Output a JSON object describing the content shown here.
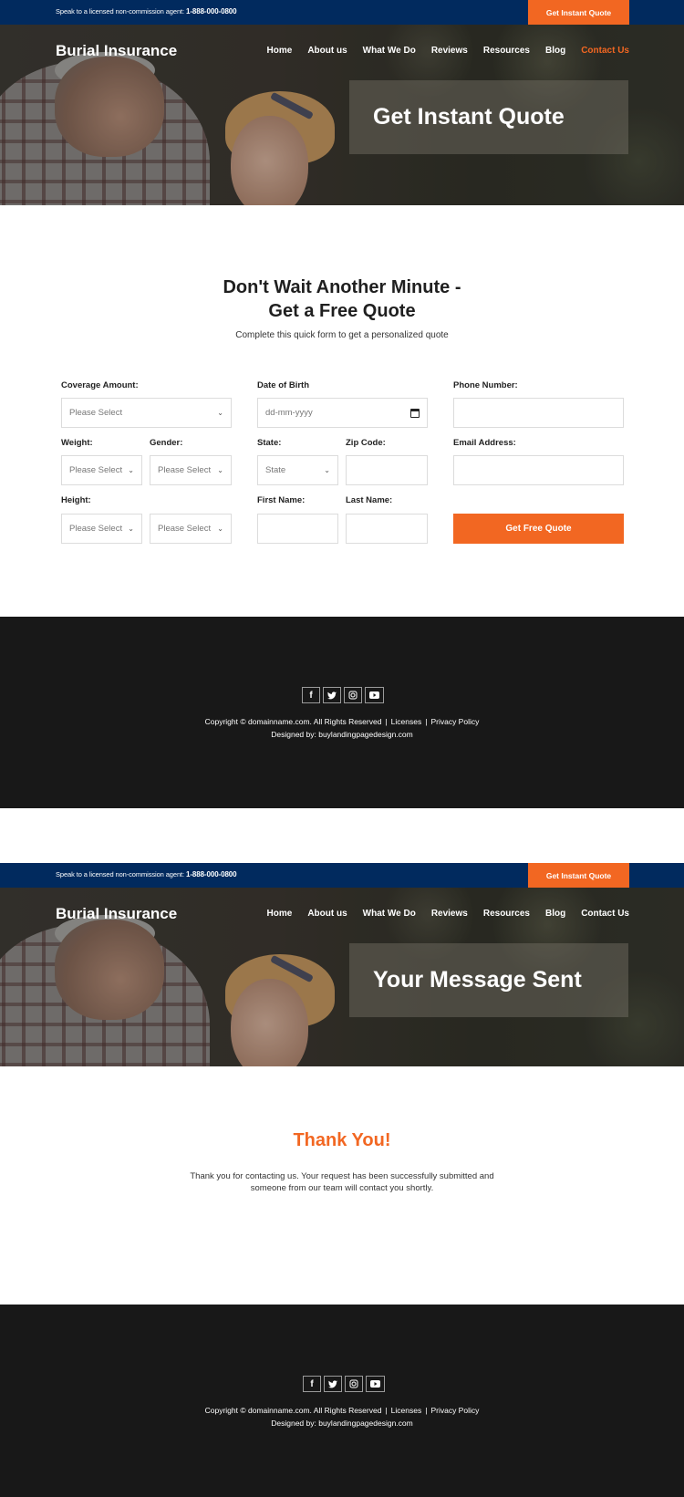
{
  "colors": {
    "navy": "#012a5e",
    "orange": "#f26722",
    "footer_bg": "#181818"
  },
  "topbar": {
    "agent_text": "Speak to a licensed non-commission agent: ",
    "phone": "1-888-000-0800",
    "quote_button": "Get Instant Quote"
  },
  "header": {
    "brand": "Burial Insurance",
    "nav": [
      "Home",
      "About us",
      "What We Do",
      "Reviews",
      "Resources",
      "Blog",
      "Contact Us"
    ]
  },
  "page1": {
    "hero_title": "Get Instant Quote",
    "heading_line1": "Don't Wait Another Minute -",
    "heading_line2": "Get a Free Quote",
    "subheading": "Complete this quick form to get a personalized quote",
    "form": {
      "coverage_label": "Coverage Amount:",
      "coverage_value": "Please Select",
      "weight_label": "Weight:",
      "weight_value": "Please Select",
      "gender_label": "Gender:",
      "gender_value": "Please Select",
      "height_label": "Height:",
      "height_feet_value": "Please Select",
      "height_inches_value": "Please Select",
      "dob_label": "Date of Birth",
      "dob_placeholder": "dd-mm-yyyy",
      "state_label": "State:",
      "state_value": "State",
      "zip_label": "Zip Code:",
      "zip_value": "",
      "first_name_label": "First Name:",
      "first_name_value": "",
      "last_name_label": "Last Name:",
      "last_name_value": "",
      "phone_label": "Phone Number:",
      "phone_value": "",
      "email_label": "Email Address:",
      "email_value": "",
      "submit": "Get Free Quote"
    }
  },
  "page2": {
    "hero_title": "Your Message Sent",
    "thank_you_title": "Thank You!",
    "thank_you_text": "Thank you for contacting us. Your request has been successfully submitted and someone from our team will contact you shortly."
  },
  "footer": {
    "social_icons": [
      "facebook-icon",
      "twitter-icon",
      "instagram-icon",
      "youtube-icon"
    ],
    "copyright": "Copyright © domainname.com. All Rights Reserved",
    "separator": "|",
    "licenses": "Licenses",
    "privacy": "Privacy Policy",
    "designed_by": "Designed by: buylandingpagedesign.com"
  }
}
